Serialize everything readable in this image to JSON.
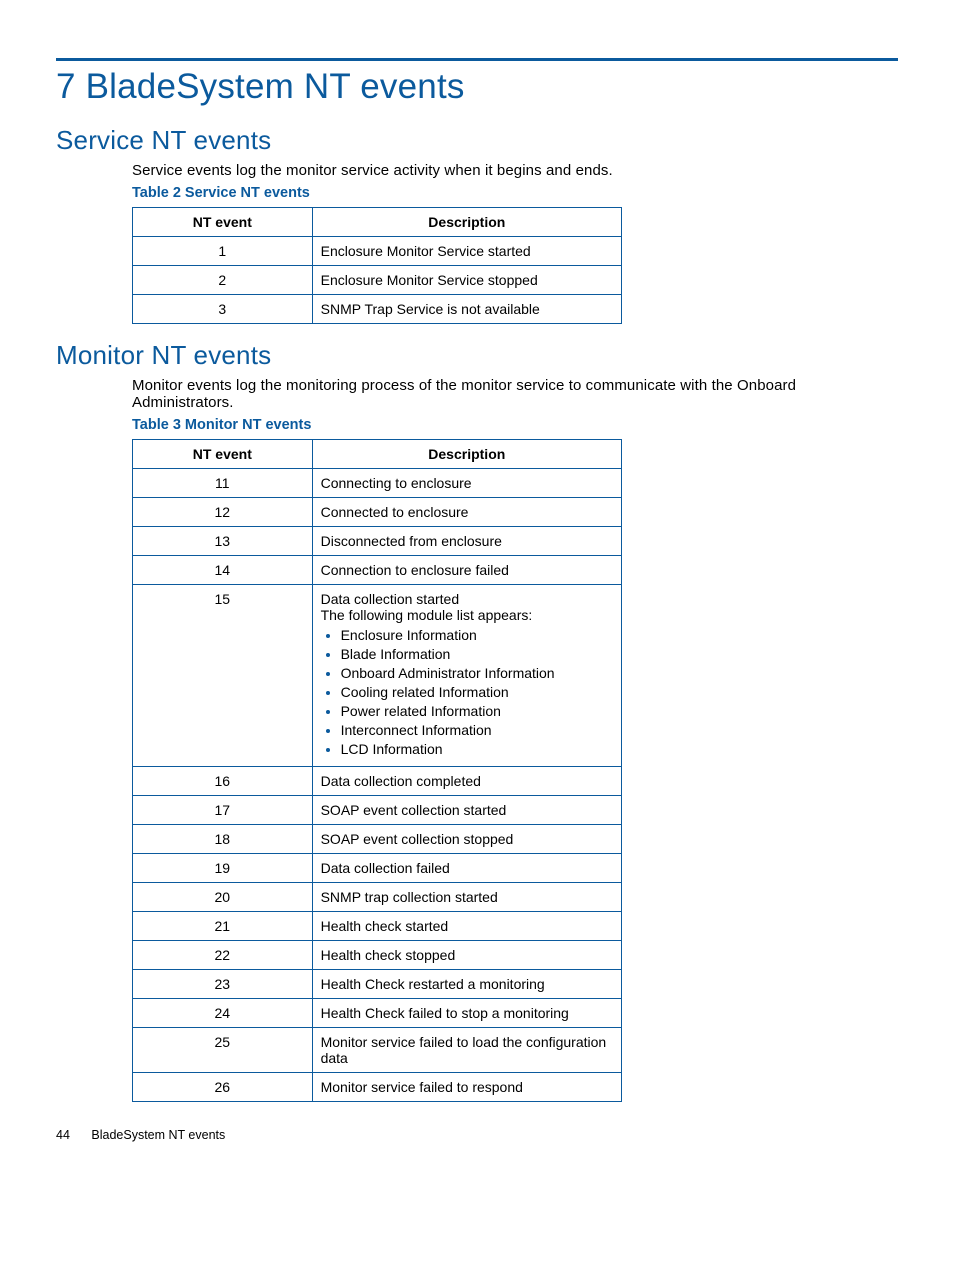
{
  "chapter_title": "7 BladeSystem NT events",
  "section1": {
    "title": "Service NT events",
    "intro": "Service events log the monitor service activity when it begins and ends.",
    "table_caption": "Table 2 Service NT events",
    "headers": {
      "event": "NT event",
      "desc": "Description"
    },
    "rows": [
      {
        "id": "1",
        "desc": "Enclosure Monitor Service started"
      },
      {
        "id": "2",
        "desc": "Enclosure Monitor Service stopped"
      },
      {
        "id": "3",
        "desc": "SNMP Trap Service is not available"
      }
    ]
  },
  "section2": {
    "title": "Monitor NT events",
    "intro": "Monitor events log the monitoring process of the monitor service to communicate with the Onboard Administrators.",
    "table_caption": "Table 3 Monitor NT events",
    "headers": {
      "event": "NT event",
      "desc": "Description"
    },
    "rows": [
      {
        "id": "11",
        "desc": "Connecting to enclosure"
      },
      {
        "id": "12",
        "desc": "Connected to enclosure"
      },
      {
        "id": "13",
        "desc": "Disconnected from enclosure"
      },
      {
        "id": "14",
        "desc": "Connection to enclosure failed"
      },
      {
        "id": "15",
        "desc_pre": "Data collection started\nThe following module list appears:",
        "bullets": [
          "Enclosure Information",
          "Blade Information",
          "Onboard Administrator Information",
          "Cooling related Information",
          "Power related Information",
          "Interconnect Information",
          "LCD Information"
        ]
      },
      {
        "id": "16",
        "desc": "Data collection completed"
      },
      {
        "id": "17",
        "desc": "SOAP event collection started"
      },
      {
        "id": "18",
        "desc": "SOAP event collection stopped"
      },
      {
        "id": "19",
        "desc": "Data collection failed"
      },
      {
        "id": "20",
        "desc": "SNMP trap collection started"
      },
      {
        "id": "21",
        "desc": "Health check started"
      },
      {
        "id": "22",
        "desc": "Health check stopped"
      },
      {
        "id": "23",
        "desc": "Health Check restarted a monitoring"
      },
      {
        "id": "24",
        "desc": "Health Check failed to stop a monitoring"
      },
      {
        "id": "25",
        "desc": "Monitor service failed to load the configuration data"
      },
      {
        "id": "26",
        "desc": "Monitor service failed to respond"
      }
    ]
  },
  "footer": {
    "page": "44",
    "title": "BladeSystem NT events"
  }
}
